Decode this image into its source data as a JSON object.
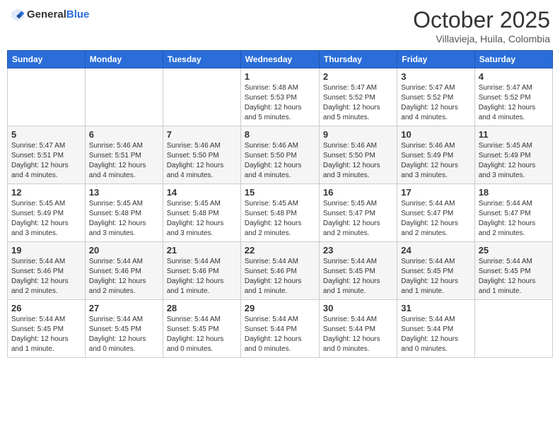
{
  "header": {
    "logo_general": "General",
    "logo_blue": "Blue",
    "month_title": "October 2025",
    "subtitle": "Villavieja, Huila, Colombia"
  },
  "weekdays": [
    "Sunday",
    "Monday",
    "Tuesday",
    "Wednesday",
    "Thursday",
    "Friday",
    "Saturday"
  ],
  "weeks": [
    [
      {
        "day": "",
        "detail": ""
      },
      {
        "day": "",
        "detail": ""
      },
      {
        "day": "",
        "detail": ""
      },
      {
        "day": "1",
        "detail": "Sunrise: 5:48 AM\nSunset: 5:53 PM\nDaylight: 12 hours\nand 5 minutes."
      },
      {
        "day": "2",
        "detail": "Sunrise: 5:47 AM\nSunset: 5:52 PM\nDaylight: 12 hours\nand 5 minutes."
      },
      {
        "day": "3",
        "detail": "Sunrise: 5:47 AM\nSunset: 5:52 PM\nDaylight: 12 hours\nand 4 minutes."
      },
      {
        "day": "4",
        "detail": "Sunrise: 5:47 AM\nSunset: 5:52 PM\nDaylight: 12 hours\nand 4 minutes."
      }
    ],
    [
      {
        "day": "5",
        "detail": "Sunrise: 5:47 AM\nSunset: 5:51 PM\nDaylight: 12 hours\nand 4 minutes."
      },
      {
        "day": "6",
        "detail": "Sunrise: 5:46 AM\nSunset: 5:51 PM\nDaylight: 12 hours\nand 4 minutes."
      },
      {
        "day": "7",
        "detail": "Sunrise: 5:46 AM\nSunset: 5:50 PM\nDaylight: 12 hours\nand 4 minutes."
      },
      {
        "day": "8",
        "detail": "Sunrise: 5:46 AM\nSunset: 5:50 PM\nDaylight: 12 hours\nand 4 minutes."
      },
      {
        "day": "9",
        "detail": "Sunrise: 5:46 AM\nSunset: 5:50 PM\nDaylight: 12 hours\nand 3 minutes."
      },
      {
        "day": "10",
        "detail": "Sunrise: 5:46 AM\nSunset: 5:49 PM\nDaylight: 12 hours\nand 3 minutes."
      },
      {
        "day": "11",
        "detail": "Sunrise: 5:45 AM\nSunset: 5:49 PM\nDaylight: 12 hours\nand 3 minutes."
      }
    ],
    [
      {
        "day": "12",
        "detail": "Sunrise: 5:45 AM\nSunset: 5:49 PM\nDaylight: 12 hours\nand 3 minutes."
      },
      {
        "day": "13",
        "detail": "Sunrise: 5:45 AM\nSunset: 5:48 PM\nDaylight: 12 hours\nand 3 minutes."
      },
      {
        "day": "14",
        "detail": "Sunrise: 5:45 AM\nSunset: 5:48 PM\nDaylight: 12 hours\nand 3 minutes."
      },
      {
        "day": "15",
        "detail": "Sunrise: 5:45 AM\nSunset: 5:48 PM\nDaylight: 12 hours\nand 2 minutes."
      },
      {
        "day": "16",
        "detail": "Sunrise: 5:45 AM\nSunset: 5:47 PM\nDaylight: 12 hours\nand 2 minutes."
      },
      {
        "day": "17",
        "detail": "Sunrise: 5:44 AM\nSunset: 5:47 PM\nDaylight: 12 hours\nand 2 minutes."
      },
      {
        "day": "18",
        "detail": "Sunrise: 5:44 AM\nSunset: 5:47 PM\nDaylight: 12 hours\nand 2 minutes."
      }
    ],
    [
      {
        "day": "19",
        "detail": "Sunrise: 5:44 AM\nSunset: 5:46 PM\nDaylight: 12 hours\nand 2 minutes."
      },
      {
        "day": "20",
        "detail": "Sunrise: 5:44 AM\nSunset: 5:46 PM\nDaylight: 12 hours\nand 2 minutes."
      },
      {
        "day": "21",
        "detail": "Sunrise: 5:44 AM\nSunset: 5:46 PM\nDaylight: 12 hours\nand 1 minute."
      },
      {
        "day": "22",
        "detail": "Sunrise: 5:44 AM\nSunset: 5:46 PM\nDaylight: 12 hours\nand 1 minute."
      },
      {
        "day": "23",
        "detail": "Sunrise: 5:44 AM\nSunset: 5:45 PM\nDaylight: 12 hours\nand 1 minute."
      },
      {
        "day": "24",
        "detail": "Sunrise: 5:44 AM\nSunset: 5:45 PM\nDaylight: 12 hours\nand 1 minute."
      },
      {
        "day": "25",
        "detail": "Sunrise: 5:44 AM\nSunset: 5:45 PM\nDaylight: 12 hours\nand 1 minute."
      }
    ],
    [
      {
        "day": "26",
        "detail": "Sunrise: 5:44 AM\nSunset: 5:45 PM\nDaylight: 12 hours\nand 1 minute."
      },
      {
        "day": "27",
        "detail": "Sunrise: 5:44 AM\nSunset: 5:45 PM\nDaylight: 12 hours\nand 0 minutes."
      },
      {
        "day": "28",
        "detail": "Sunrise: 5:44 AM\nSunset: 5:45 PM\nDaylight: 12 hours\nand 0 minutes."
      },
      {
        "day": "29",
        "detail": "Sunrise: 5:44 AM\nSunset: 5:44 PM\nDaylight: 12 hours\nand 0 minutes."
      },
      {
        "day": "30",
        "detail": "Sunrise: 5:44 AM\nSunset: 5:44 PM\nDaylight: 12 hours\nand 0 minutes."
      },
      {
        "day": "31",
        "detail": "Sunrise: 5:44 AM\nSunset: 5:44 PM\nDaylight: 12 hours\nand 0 minutes."
      },
      {
        "day": "",
        "detail": ""
      }
    ]
  ]
}
